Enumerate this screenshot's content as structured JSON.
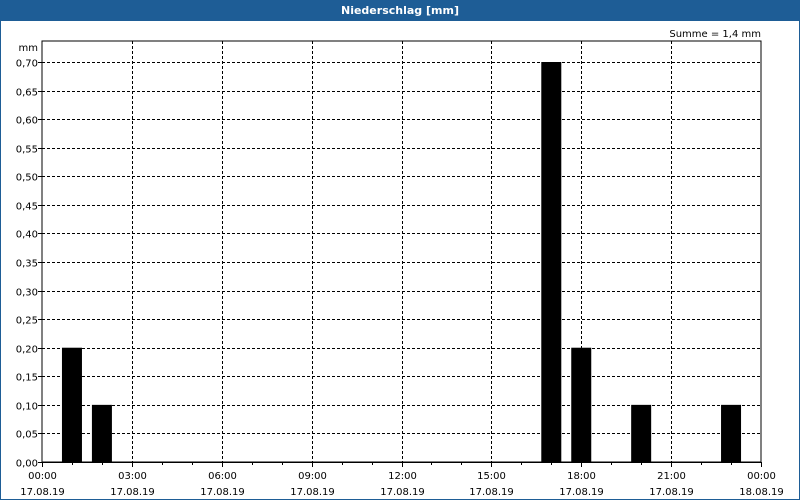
{
  "window": {
    "title": "Niederschlag [mm]"
  },
  "chart_data": {
    "type": "bar",
    "title": "Niederschlag [mm]",
    "ylabel": "mm",
    "summary": "Summe = 1,4 mm",
    "ylim": [
      0,
      0.7
    ],
    "xlim_hours": [
      0,
      24
    ],
    "y_ticks": [
      0,
      0.05,
      0.1,
      0.15,
      0.2,
      0.25,
      0.3,
      0.35,
      0.4,
      0.45,
      0.5,
      0.55,
      0.6,
      0.65,
      0.7
    ],
    "y_tick_labels": [
      "0,00",
      "0,05",
      "0,10",
      "0,15",
      "0,20",
      "0,25",
      "0,30",
      "0,35",
      "0,40",
      "0,45",
      "0,50",
      "0,55",
      "0,60",
      "0,65",
      "0,70"
    ],
    "x_ticks_hours": [
      0,
      3,
      6,
      9,
      12,
      15,
      18,
      21,
      24
    ],
    "x_tick_labels": [
      [
        "00:00",
        "17.08.19"
      ],
      [
        "03:00",
        "17.08.19"
      ],
      [
        "06:00",
        "17.08.19"
      ],
      [
        "09:00",
        "17.08.19"
      ],
      [
        "12:00",
        "17.08.19"
      ],
      [
        "15:00",
        "17.08.19"
      ],
      [
        "18:00",
        "17.08.19"
      ],
      [
        "21:00",
        "17.08.19"
      ],
      [
        "00:00",
        "18.08.19"
      ]
    ],
    "grid": true,
    "bar_color": "#000000",
    "bars": [
      {
        "hour": 1,
        "value": 0.2
      },
      {
        "hour": 2,
        "value": 0.1
      },
      {
        "hour": 17,
        "value": 0.7
      },
      {
        "hour": 18,
        "value": 0.2
      },
      {
        "hour": 20,
        "value": 0.1
      },
      {
        "hour": 23,
        "value": 0.1
      }
    ]
  }
}
